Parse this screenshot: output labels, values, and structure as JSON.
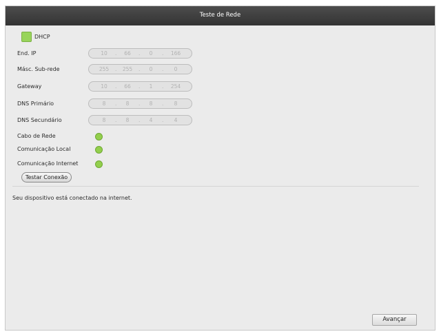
{
  "window": {
    "title": "Teste de Rede"
  },
  "dhcp": {
    "label": "DHCP",
    "checked": true
  },
  "fields": [
    {
      "label": "End. IP",
      "octets": [
        "10",
        "66",
        "0",
        "166"
      ]
    },
    {
      "label": "Másc. Sub-rede",
      "octets": [
        "255",
        "255",
        "0",
        "0"
      ]
    },
    {
      "label": "Gateway",
      "octets": [
        "10",
        "66",
        "1",
        "254"
      ]
    },
    {
      "label": "DNS Primário",
      "octets": [
        "8",
        "8",
        "8",
        "8"
      ]
    },
    {
      "label": "DNS Secundário",
      "octets": [
        "8",
        "8",
        "4",
        "4"
      ]
    }
  ],
  "indicators": [
    {
      "label": "Cabo de Rede",
      "color": "#93cf4d"
    },
    {
      "label": "Comunicação Local",
      "color": "#93cf4d"
    },
    {
      "label": "Comunicação Internet",
      "color": "#93cf4d"
    }
  ],
  "buttons": {
    "test": "Testar Conexão",
    "next": "Avançar"
  },
  "status_message": "Seu dispositivo está conectado na internet."
}
